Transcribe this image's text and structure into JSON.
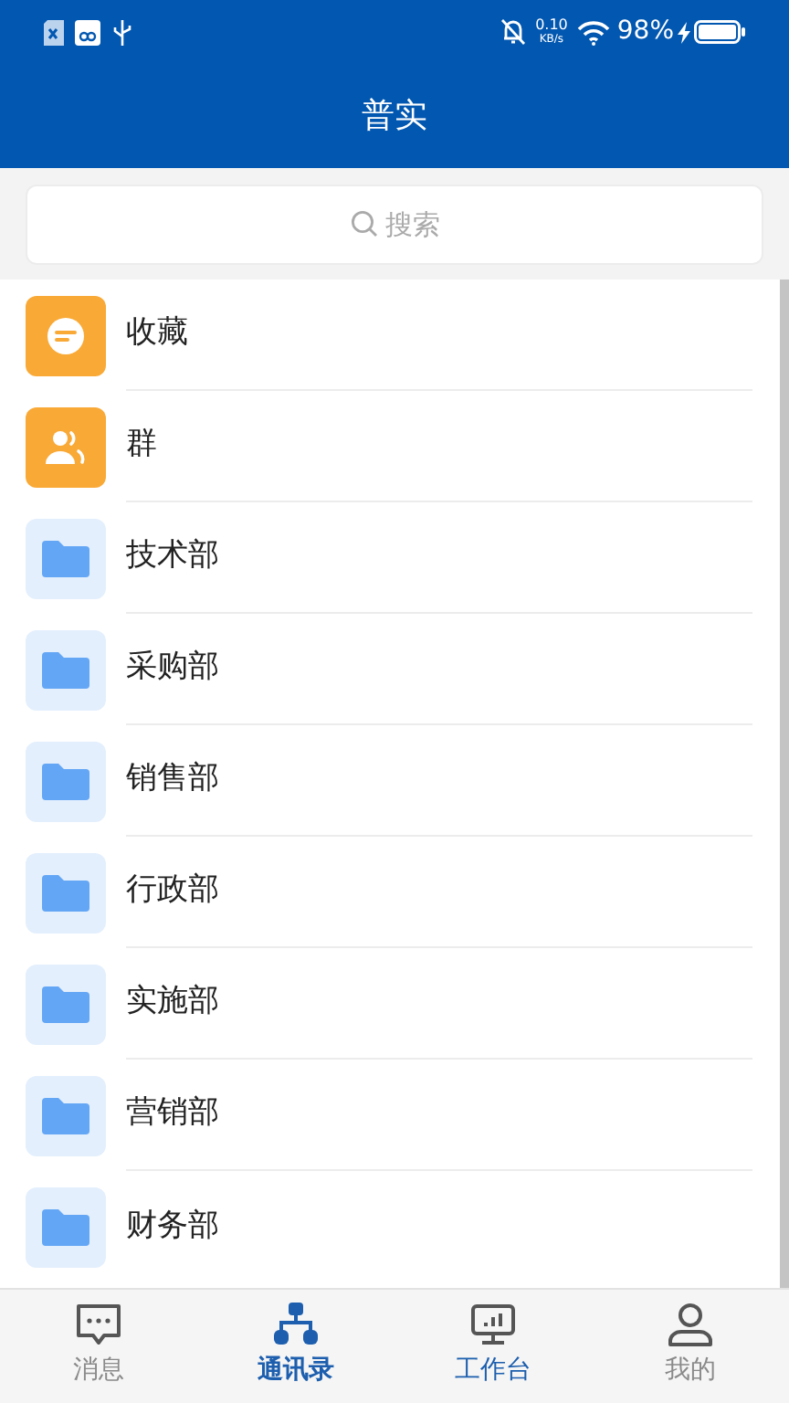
{
  "status_bar": {
    "speed": "0.10",
    "speed_unit": "KB/s",
    "battery": "98%"
  },
  "header": {
    "title": "普实"
  },
  "search": {
    "placeholder": "搜索"
  },
  "contacts": [
    {
      "kind": "favorites",
      "label": "收藏"
    },
    {
      "kind": "group",
      "label": "群"
    },
    {
      "kind": "folder",
      "label": "技术部"
    },
    {
      "kind": "folder",
      "label": "采购部"
    },
    {
      "kind": "folder",
      "label": "销售部"
    },
    {
      "kind": "folder",
      "label": "行政部"
    },
    {
      "kind": "folder",
      "label": "实施部"
    },
    {
      "kind": "folder",
      "label": "营销部"
    },
    {
      "kind": "folder",
      "label": "财务部"
    }
  ],
  "tab_bar": [
    {
      "kind": "messages",
      "label": "消息",
      "selected": false,
      "color": "#8a8a8a"
    },
    {
      "kind": "contacts",
      "label": "通讯录",
      "selected": true,
      "color": "#1d5fae"
    },
    {
      "kind": "workbench",
      "label": "工作台",
      "selected": false,
      "color": "#1d5fae"
    },
    {
      "kind": "profile",
      "label": "我的",
      "selected": false,
      "color": "#8a8a8a"
    }
  ]
}
